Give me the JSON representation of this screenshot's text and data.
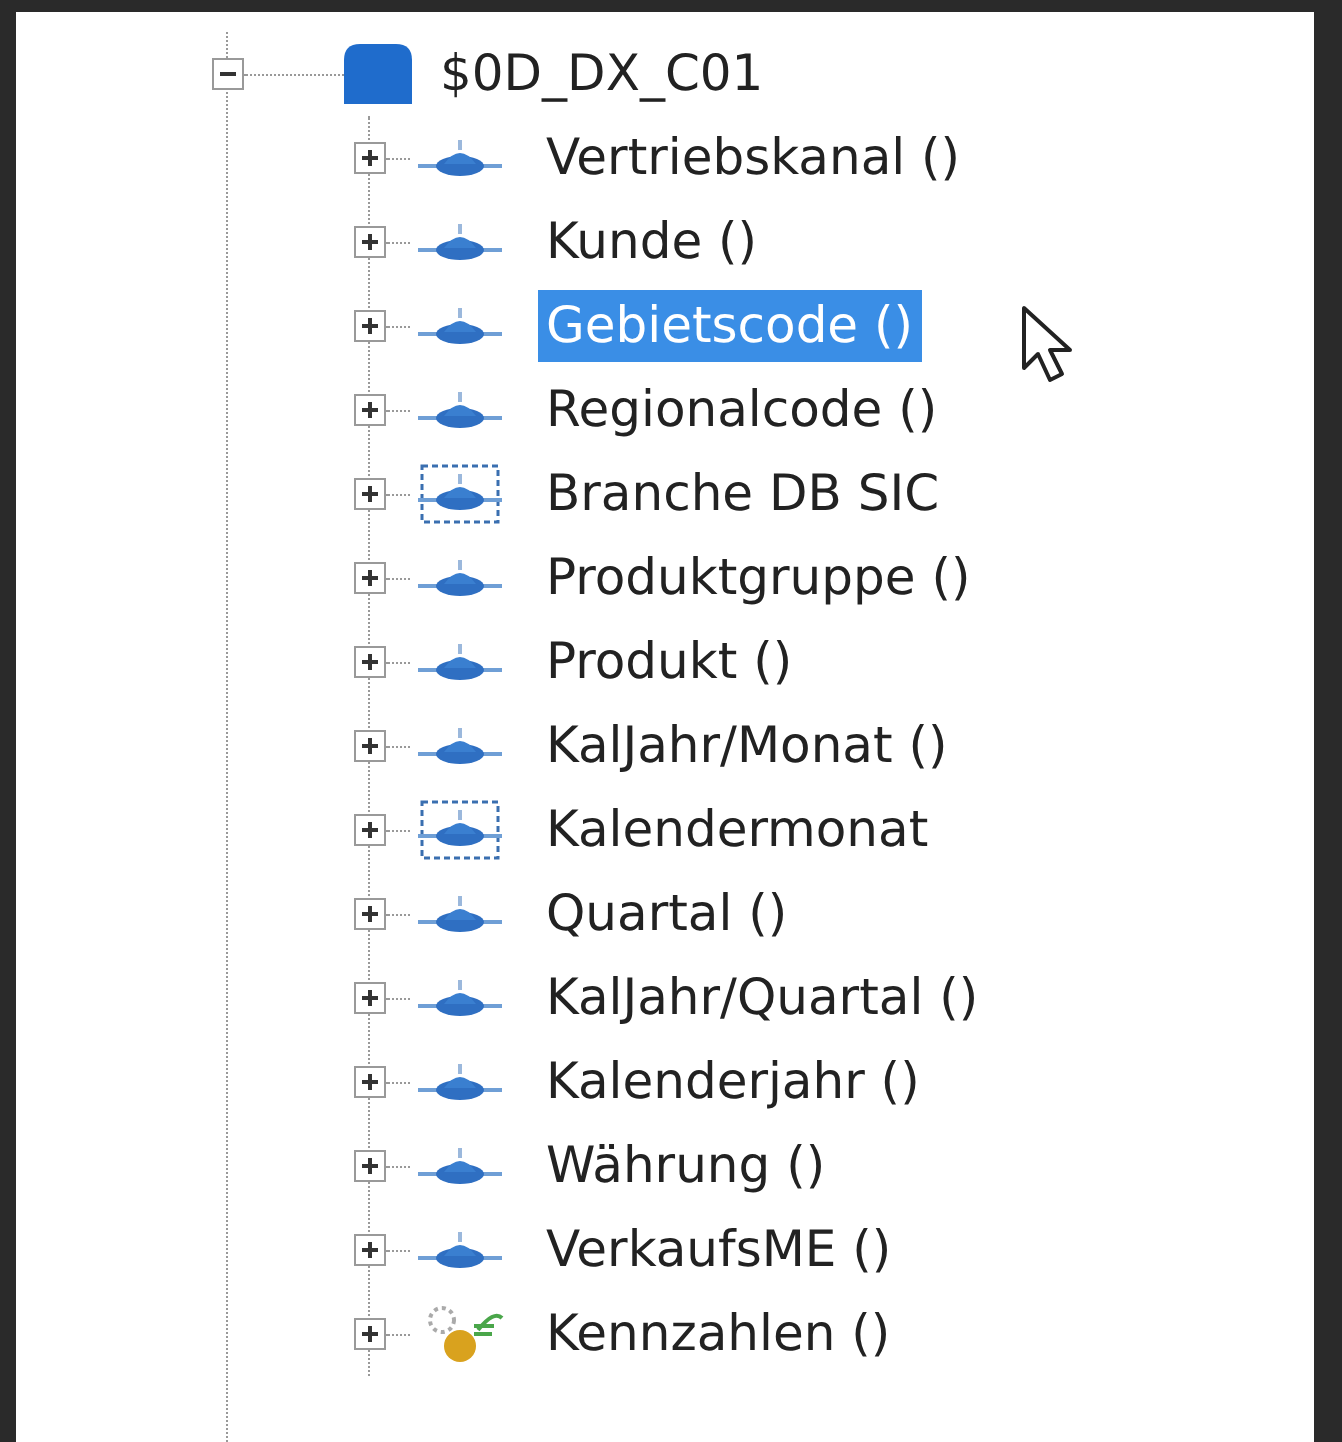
{
  "tree": {
    "label": "$0D_DX_C01",
    "kind": "cube",
    "expanded": true,
    "selected": false,
    "children": [
      {
        "label": "Vertriebskanal ()",
        "kind": "characteristic",
        "expanded": false,
        "selected": false
      },
      {
        "label": "Kunde ()",
        "kind": "characteristic",
        "expanded": false,
        "selected": false
      },
      {
        "label": "Gebietscode ()",
        "kind": "characteristic",
        "expanded": false,
        "selected": true
      },
      {
        "label": "Regionalcode ()",
        "kind": "characteristic",
        "expanded": false,
        "selected": false
      },
      {
        "label": "Branche DB SIC",
        "kind": "navigation",
        "expanded": false,
        "selected": false
      },
      {
        "label": "Produktgruppe ()",
        "kind": "characteristic",
        "expanded": false,
        "selected": false
      },
      {
        "label": "Produkt ()",
        "kind": "characteristic",
        "expanded": false,
        "selected": false
      },
      {
        "label": "KalJahr/Monat ()",
        "kind": "characteristic",
        "expanded": false,
        "selected": false
      },
      {
        "label": "Kalendermonat",
        "kind": "navigation",
        "expanded": false,
        "selected": false
      },
      {
        "label": "Quartal ()",
        "kind": "characteristic",
        "expanded": false,
        "selected": false
      },
      {
        "label": "KalJahr/Quartal ()",
        "kind": "characteristic",
        "expanded": false,
        "selected": false
      },
      {
        "label": "Kalenderjahr ()",
        "kind": "characteristic",
        "expanded": false,
        "selected": false
      },
      {
        "label": "Währung ()",
        "kind": "characteristic",
        "expanded": false,
        "selected": false
      },
      {
        "label": "VerkaufsME ()",
        "kind": "characteristic",
        "expanded": false,
        "selected": false
      },
      {
        "label": "Kennzahlen ()",
        "kind": "keyfigure",
        "expanded": false,
        "selected": false
      }
    ]
  }
}
